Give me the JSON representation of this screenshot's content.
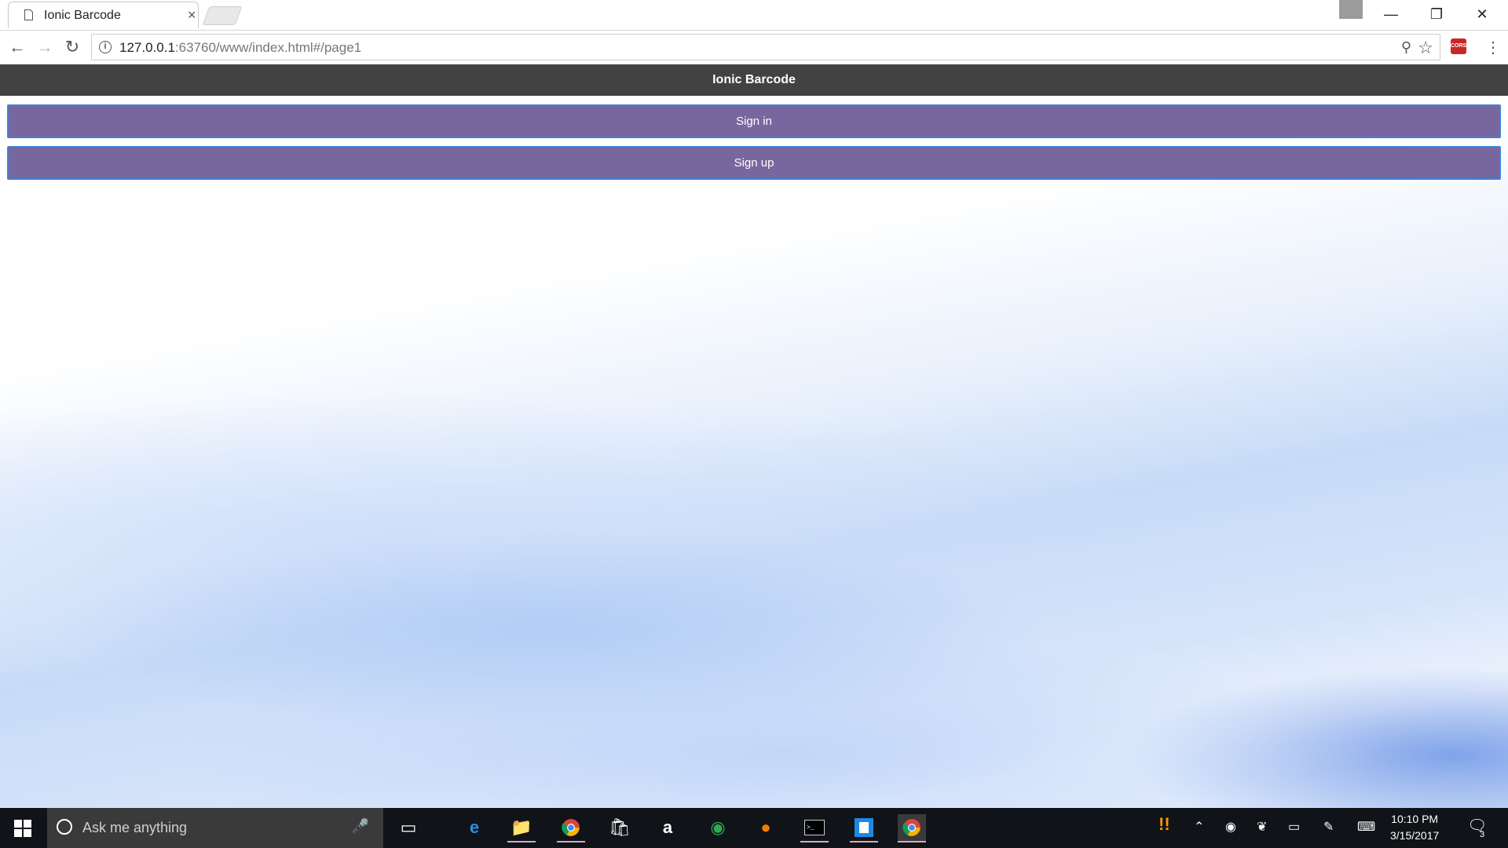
{
  "browser": {
    "tab_title": "Ionic Barcode",
    "tab_close": "×",
    "url_host": "127.0.0.1",
    "url_rest": ":63760/www/index.html#/page1",
    "ext_label": "CORS",
    "window_minimize": "—",
    "window_restore": "❐",
    "window_close": "✕",
    "menu_glyph": "⋮"
  },
  "app": {
    "header_title": "Ionic Barcode",
    "buttons": [
      {
        "label": "Sign in"
      },
      {
        "label": "Sign up"
      }
    ]
  },
  "taskbar": {
    "search_placeholder": "Ask me anything",
    "icons": [
      "task-view-icon",
      "edge-icon",
      "file-explorer-icon",
      "chrome-icon",
      "store-icon",
      "amazon-icon",
      "tripadvisor-icon",
      "firefox-icon",
      "terminal-icon",
      "app-icon",
      "chrome-active-icon"
    ],
    "time": "10:10 PM",
    "date": "3/15/2017",
    "notification_count": "3"
  },
  "colors": {
    "header": "#424242",
    "button": "#77679e",
    "button_border": "#3f82d9"
  }
}
